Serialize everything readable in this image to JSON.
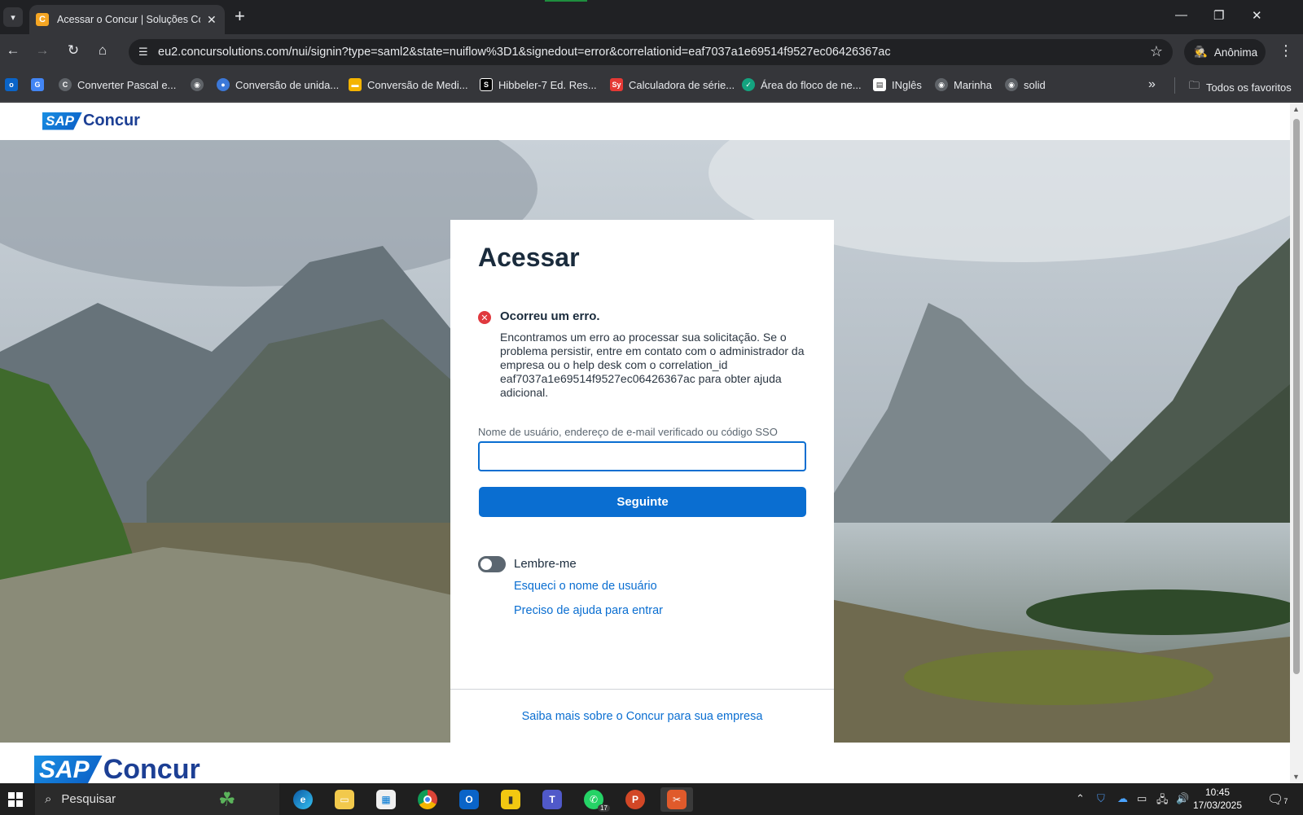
{
  "browser": {
    "tab_title": "Acessar o Concur | Soluções Co",
    "tab_favicon": "C",
    "url": "eu2.concursolutions.com/nui/signin?type=saml2&state=nuiflow%3D1&signedout=error&correlationid=eaf7037a1e69514f9527ec06426367ac",
    "profile_label": "Anônima",
    "bookmarks": [
      {
        "label": "Converter Pascal e...",
        "icon_color": "#5f6368"
      },
      {
        "label": "Conversão de unida...",
        "icon_color": "#3c78d8"
      },
      {
        "label": "Conversão de Medi...",
        "icon_color": "#f4b400"
      },
      {
        "label": "Hibbeler-7 Ed. Res...",
        "icon_color": "#000000"
      },
      {
        "label": "Calculadora de série...",
        "icon_color": "#e53935"
      },
      {
        "label": "Área do floco de ne...",
        "icon_color": "#14a37f"
      },
      {
        "label": "INglês",
        "icon_color": "#ffffff"
      },
      {
        "label": "Marinha",
        "icon_color": "#5f6368"
      },
      {
        "label": "solid",
        "icon_color": "#5f6368"
      }
    ],
    "all_bookmarks_label": "Todos os favoritos"
  },
  "page": {
    "logo_sap": "SAP",
    "logo_concur": "Concur",
    "card": {
      "title": "Acessar",
      "error_title": "Ocorreu um erro.",
      "error_body": "Encontramos um erro ao processar sua solicitação. Se o problema persistir, entre em contato com o administrador da empresa ou o help desk com o correlation_id eaf7037a1e69514f9527ec06426367ac para obter ajuda adicional.",
      "field_label": "Nome de usuário, endereço de e-mail verificado ou código SSO",
      "field_value": "",
      "next_button": "Seguinte",
      "remember_label": "Lembre-me",
      "remember_on": false,
      "forgot_link": "Esqueci o nome de usuário",
      "help_link": "Preciso de ajuda para entrar",
      "footer_link": "Saiba mais sobre o Concur para sua empresa"
    }
  },
  "taskbar": {
    "search_placeholder": "Pesquisar",
    "whatsapp_badge": "17",
    "time": "10:45",
    "date": "17/03/2025",
    "notifications": "7"
  },
  "colors": {
    "accent": "#0a6ed1",
    "error": "#e0393e",
    "brand_blue": "#1c3f94"
  }
}
